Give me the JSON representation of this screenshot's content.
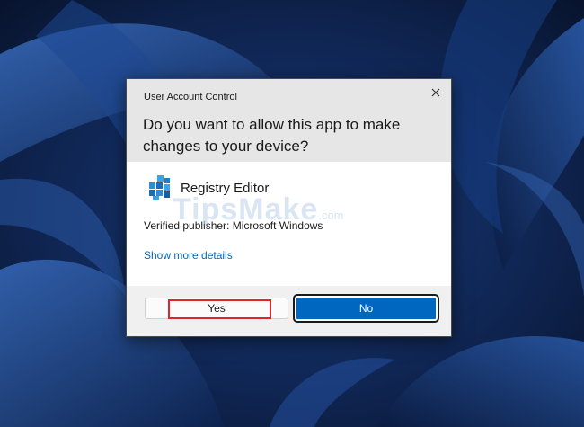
{
  "desktop": {
    "background_color": "#0c1a36",
    "accent_color": "#1a4f9c"
  },
  "dialog": {
    "caption": "User Account Control",
    "question": "Do you want to allow this app to make changes to your device?",
    "close_icon": "close-icon",
    "app": {
      "name": "Registry Editor",
      "icon": "registry-editor-icon"
    },
    "publisher": "Verified publisher: Microsoft Windows",
    "details_link": "Show more details",
    "buttons": {
      "yes_label": "Yes",
      "no_label": "No"
    },
    "highlight_color": "#e0262a",
    "primary_button_color": "#0067c0"
  },
  "watermark": {
    "text": "TipsMake",
    "suffix": ".com"
  }
}
